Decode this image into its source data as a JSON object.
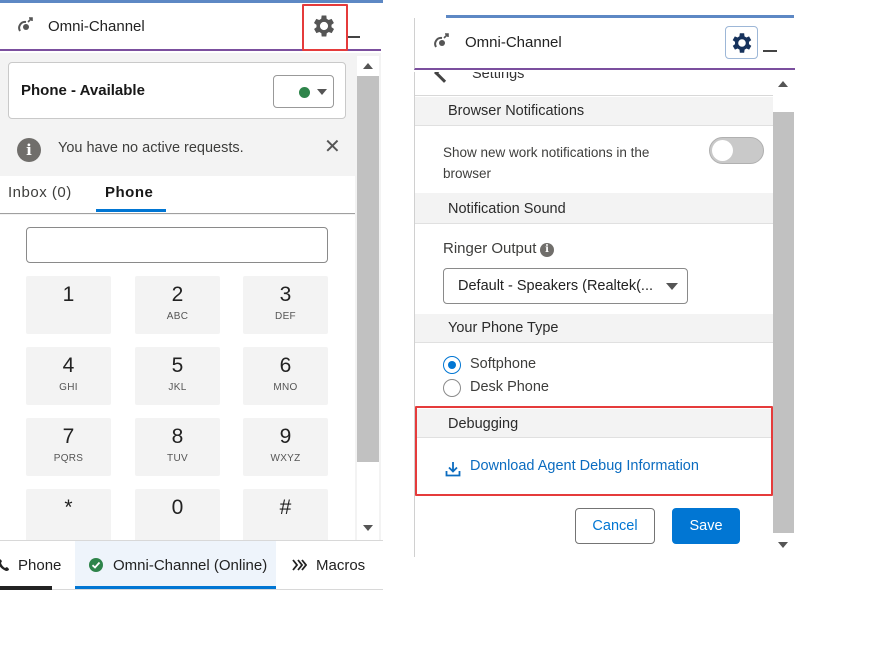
{
  "left_panel": {
    "header": {
      "title": "Omni-Channel"
    },
    "status": {
      "label": "Phone - Available",
      "indicator_color": "#2e844a"
    },
    "notice": {
      "info_glyph": "i",
      "text": "You have no active requests.",
      "close_glyph": "✕"
    },
    "tabs": [
      {
        "label": "Inbox (0)",
        "active": false
      },
      {
        "label": "Phone",
        "active": true
      }
    ],
    "dialer": {
      "input_value": "",
      "keys": [
        {
          "num": "1",
          "letters": ""
        },
        {
          "num": "2",
          "letters": "ABC"
        },
        {
          "num": "3",
          "letters": "DEF"
        },
        {
          "num": "4",
          "letters": "GHI"
        },
        {
          "num": "5",
          "letters": "JKL"
        },
        {
          "num": "6",
          "letters": "MNO"
        },
        {
          "num": "7",
          "letters": "PQRS"
        },
        {
          "num": "8",
          "letters": "TUV"
        },
        {
          "num": "9",
          "letters": "WXYZ"
        },
        {
          "num": "*",
          "letters": ""
        },
        {
          "num": "0",
          "letters": ""
        },
        {
          "num": "#",
          "letters": ""
        }
      ]
    },
    "utility_bar": {
      "phone_label": "Phone",
      "omni_label": "Omni-Channel (Online)",
      "macros_label": "Macros"
    }
  },
  "right_panel": {
    "header": {
      "title": "Omni-Channel"
    },
    "settings_title": "Settings",
    "sections": {
      "browser_notifications": "Browser Notifications",
      "notification_sound": "Notification Sound",
      "phone_type": "Your Phone Type",
      "debugging": "Debugging"
    },
    "browser_notification_text": "Show new work notifications in the browser",
    "browser_notification_enabled": false,
    "ringer_label": "Ringer Output",
    "ringer_info_glyph": "i",
    "ringer_value": "Default - Speakers (Realtek(...",
    "phone_types": [
      {
        "label": "Softphone",
        "checked": true
      },
      {
        "label": "Desk Phone",
        "checked": false
      }
    ],
    "download_link": "Download Agent Debug Information",
    "cancel_label": "Cancel",
    "save_label": "Save"
  },
  "colors": {
    "brand_blue": "#0176d3",
    "header_accent": "#7b4f9e",
    "highlight_red": "#e53b3b",
    "online_green": "#2e844a"
  },
  "icons": {
    "omni": "omni-channel-icon",
    "gear": "gear-icon",
    "minimize": "minimize-icon",
    "info": "info-icon",
    "close": "close-icon",
    "phone": "phone-icon",
    "check": "check-circle-icon",
    "macros": "double-chevron-icon",
    "download": "download-icon",
    "back": "chevron-left-icon"
  }
}
